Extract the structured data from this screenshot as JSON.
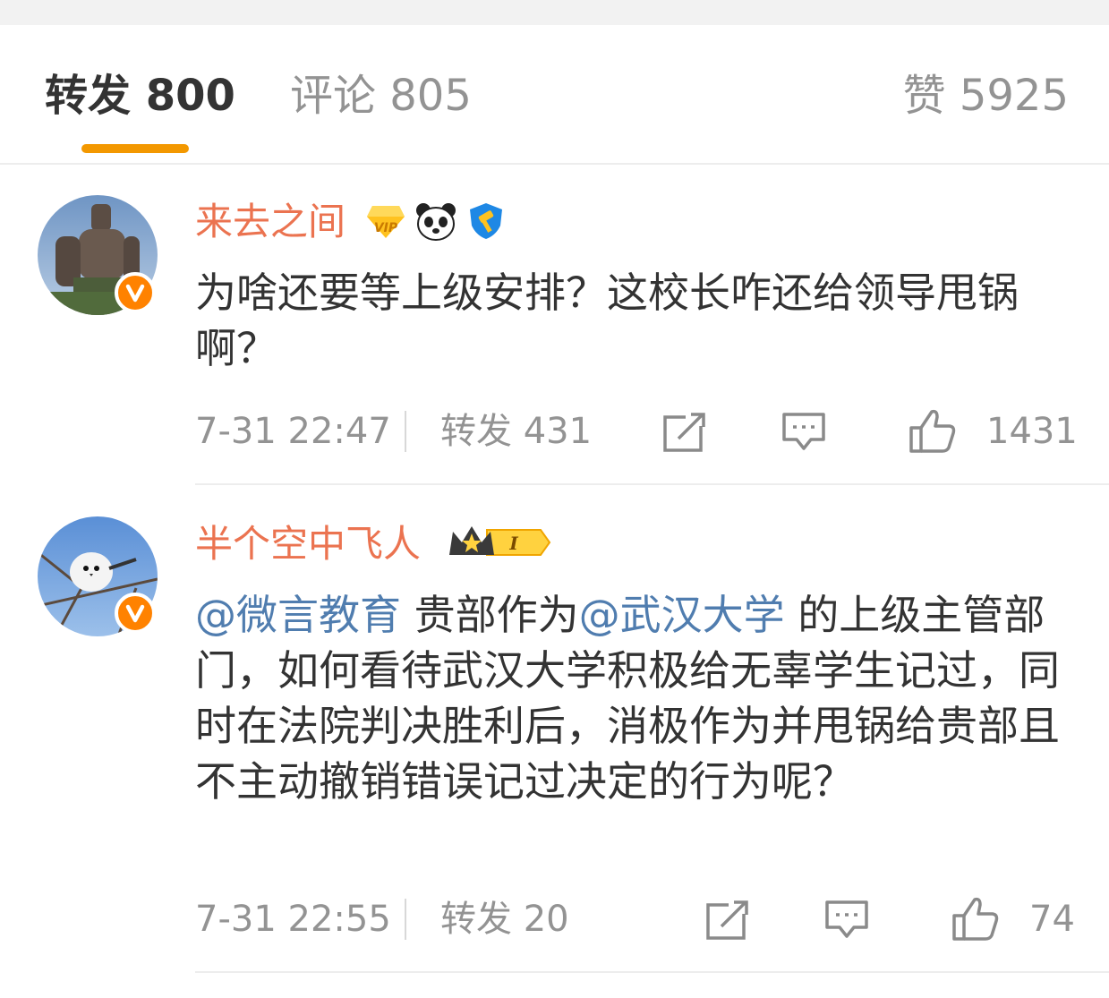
{
  "tabs": {
    "repost": "转发 800",
    "comment": "评论 805",
    "like": "赞 5925"
  },
  "colors": {
    "accent": "#f39800",
    "username": "#eb7350",
    "mention": "#507daf",
    "verified": "#ff8200"
  },
  "entries": [
    {
      "username": "来去之间",
      "text": "为啥还要等上级安排？这校长咋还给领导甩锅啊？",
      "time": "7-31 22:47",
      "repost": "转发 431",
      "likes": "1431",
      "badges": [
        "vip-diamond-icon",
        "panda-icon",
        "gavel-shield-icon"
      ]
    },
    {
      "username": "半个空中飞人",
      "mention1": "@微言教育",
      "text_a": " 贵部作为",
      "mention2": "@武汉大学",
      "text_b": " 的上级主管部门，如何看待武汉大学积极给无辜学生记过，同时在法院判决胜利后，消极作为并甩锅给贵部且不主动撤销错误记过决定的行为呢？",
      "time": "7-31 22:55",
      "repost": "转发 20",
      "likes": "74",
      "badges": [
        "crown-level-icon"
      ],
      "level": "I"
    }
  ]
}
